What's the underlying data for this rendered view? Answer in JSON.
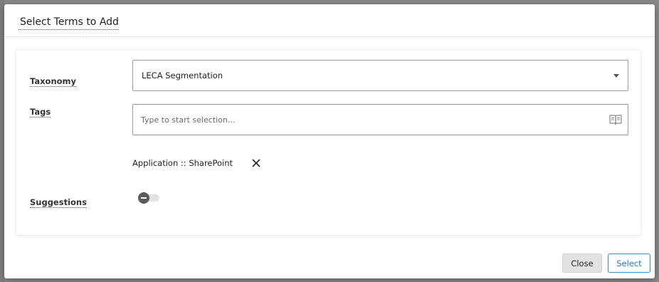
{
  "dialog": {
    "title": "Select Terms to Add"
  },
  "form": {
    "taxonomy": {
      "label": "Taxonomy",
      "selected_value": "LECA Segmentation"
    },
    "tags": {
      "label": "Tags",
      "placeholder": "Type to start selection...",
      "selected": [
        {
          "label": "Application :: SharePoint"
        }
      ]
    },
    "suggestions": {
      "label": "Suggestions",
      "enabled": false
    }
  },
  "footer": {
    "close_label": "Close",
    "select_label": "Select"
  },
  "colors": {
    "primary_accent": "#3b89c9",
    "toggle_knob": "#5b5b5b"
  },
  "icons": {
    "taxonomy_dropdown": "caret-down-icon",
    "tags_browse": "book-icon",
    "tag_remove": "close-icon"
  }
}
